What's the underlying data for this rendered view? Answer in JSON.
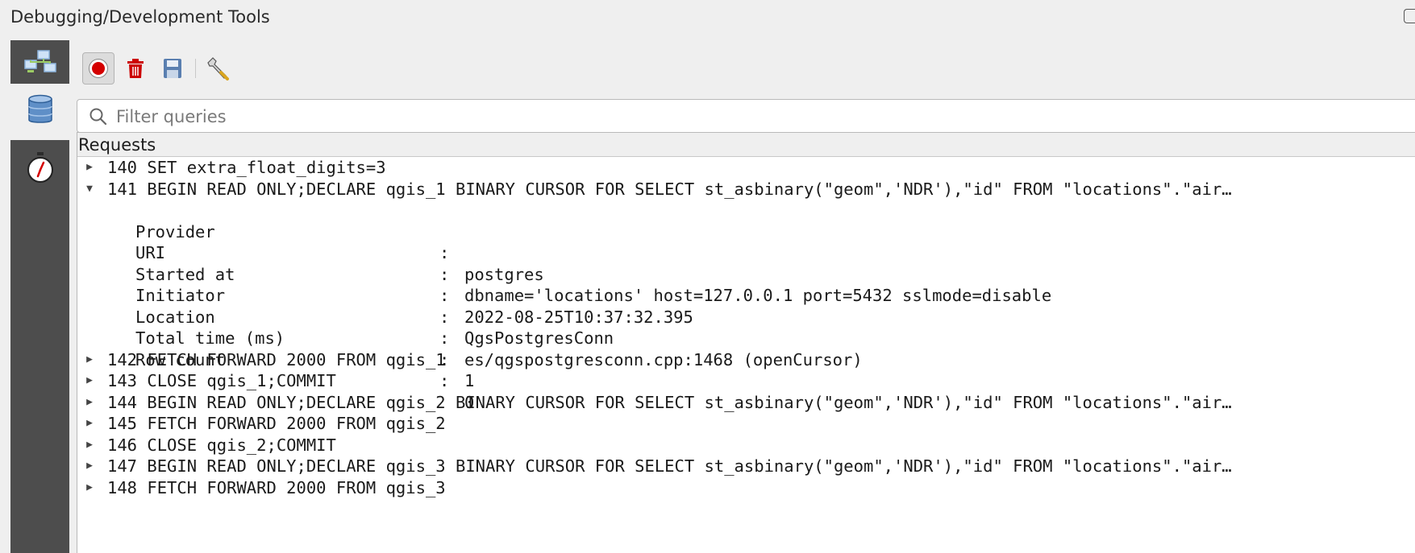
{
  "window": {
    "title": "Debugging/Development Tools"
  },
  "sidebar": {
    "tabs": [
      {
        "icon": "network-icon"
      },
      {
        "icon": "database-icon"
      },
      {
        "icon": "stopwatch-icon"
      }
    ]
  },
  "toolbar": {
    "buttons": [
      {
        "icon": "record-icon",
        "active": true
      },
      {
        "icon": "trash-icon"
      },
      {
        "icon": "save-icon"
      },
      {
        "icon": "wrench-icon"
      }
    ]
  },
  "filter": {
    "placeholder": "Filter queries",
    "value": ""
  },
  "tree": {
    "header": "Requests",
    "rows": [
      {
        "text": "140 SET extra_float_digits=3",
        "expanded": false
      },
      {
        "text": "141 BEGIN READ ONLY;DECLARE qgis_1 BINARY CURSOR FOR SELECT st_asbinary(\"geom\",'NDR'),\"id\" FROM \"locations\".\"air…",
        "expanded": true,
        "details": [
          {
            "key": "Provider",
            "value": "postgres"
          },
          {
            "key": "URI",
            "value": "dbname='locations' host=127.0.0.1 port=5432 sslmode=disable"
          },
          {
            "key": "Started at",
            "value": "2022-08-25T10:37:32.395"
          },
          {
            "key": "Initiator",
            "value": "QgsPostgresConn"
          },
          {
            "key": "Location",
            "value": "es/qgspostgresconn.cpp:1468 (openCursor)"
          },
          {
            "key": "Total time (ms)",
            "value": "1"
          },
          {
            "key": "Row count",
            "value": "0"
          }
        ]
      },
      {
        "text": "142 FETCH FORWARD 2000 FROM qgis_1",
        "expanded": false
      },
      {
        "text": "143 CLOSE qgis_1;COMMIT",
        "expanded": false
      },
      {
        "text": "144 BEGIN READ ONLY;DECLARE qgis_2 BINARY CURSOR FOR SELECT st_asbinary(\"geom\",'NDR'),\"id\" FROM \"locations\".\"air…",
        "expanded": false
      },
      {
        "text": "145 FETCH FORWARD 2000 FROM qgis_2",
        "expanded": false
      },
      {
        "text": "146 CLOSE qgis_2;COMMIT",
        "expanded": false
      },
      {
        "text": "147 BEGIN READ ONLY;DECLARE qgis_3 BINARY CURSOR FOR SELECT st_asbinary(\"geom\",'NDR'),\"id\" FROM \"locations\".\"air…",
        "expanded": false
      },
      {
        "text": "148 FETCH FORWARD 2000 FROM qgis_3",
        "expanded": false
      }
    ]
  },
  "colors": {
    "record": "#d40000",
    "trash": "#cc0000",
    "save": "#5a7fb0",
    "sidebar_active": "#4d4d4d"
  }
}
